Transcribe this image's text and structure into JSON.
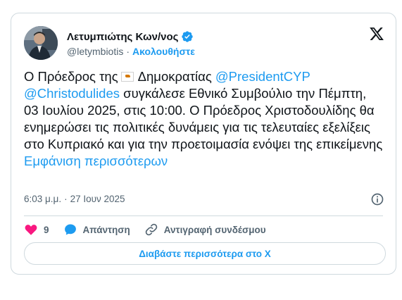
{
  "author": {
    "name": "Λετυμπιώτης Κων/νος",
    "handle": "@letymbiotis",
    "follow_label": "Ακολουθήστε",
    "separator": "·"
  },
  "tweet": {
    "text_1": "Ο Πρόεδρος της",
    "text_2": "Δημοκρατίας",
    "mention_1": "@PresidentCYP",
    "mention_2": "@Christodulides",
    "text_3": "συγκάλεσε Εθνικό Συμβούλιο την Πέμπτη, 03 Ιουλίου 2025, στις 10:00. Ο Πρόεδρος Χριστοδουλίδης θα ενημερώσει τις πολιτικές δυνάμεις για τις τελευταίες εξελίξεις στο Κυπριακό και για την προετοιμασία ενόψει της επικείμενης",
    "show_more": "Εμφάνιση περισσότερων"
  },
  "meta": {
    "time": "6:03 μ.μ.",
    "separator": "·",
    "date": "27 Ιουν 2025"
  },
  "actions": {
    "likes_count": "9",
    "reply_label": "Απάντηση",
    "copy_link_label": "Αντιγραφή συνδέσμου"
  },
  "read_more_label": "Διαβάστε περισσότερα στο X",
  "colors": {
    "accent": "#1d9bf0",
    "like": "#f91880",
    "text": "#0f1419",
    "muted": "#536471",
    "border": "#cfd9de"
  }
}
